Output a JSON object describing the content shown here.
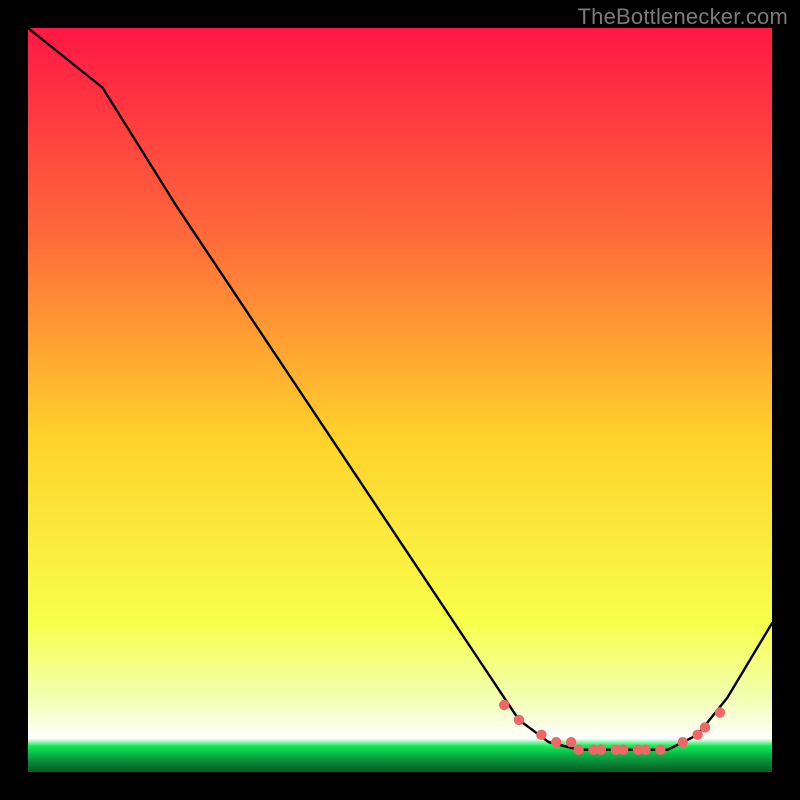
{
  "attribution": "TheBottlenecker.com",
  "colors": {
    "bg": "#000000",
    "grad_top": "#ff1745",
    "grad_mid_upper": "#ff6a3a",
    "grad_mid": "#ffd22b",
    "grad_lower": "#f7ff4a",
    "grad_band": "#f2ffb0",
    "grad_green": "#10eb55",
    "curve": "#000000",
    "marker": "#ef6767"
  },
  "chart_data": {
    "type": "line",
    "title": "",
    "xlabel": "",
    "ylabel": "",
    "xlim": [
      0,
      100
    ],
    "ylim": [
      0,
      100
    ],
    "series": [
      {
        "name": "curve",
        "x": [
          0,
          10,
          20,
          30,
          40,
          50,
          60,
          66,
          70,
          74,
          78,
          82,
          86,
          90,
          94,
          100
        ],
        "y": [
          100,
          92,
          76,
          61,
          46,
          31,
          16,
          7,
          4,
          3,
          3,
          3,
          3,
          5,
          10,
          20
        ]
      }
    ],
    "markers": {
      "name": "dots",
      "x": [
        64,
        66,
        69,
        71,
        73,
        74,
        76,
        77,
        79,
        80,
        82,
        83,
        85,
        88,
        90,
        91,
        93
      ],
      "y": [
        9,
        7,
        5,
        4,
        4,
        3,
        3,
        3,
        3,
        3,
        3,
        3,
        3,
        4,
        5,
        6,
        8
      ]
    }
  }
}
